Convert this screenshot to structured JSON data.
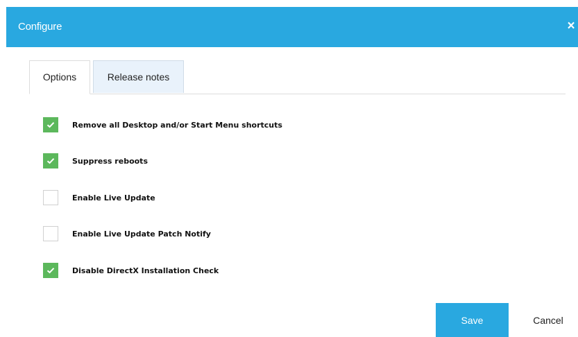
{
  "dialog": {
    "title": "Configure",
    "close_icon": "×",
    "accent_color": "#29a8e0",
    "check_color": "#5cb85c"
  },
  "tabs": [
    {
      "label": "Options",
      "active": true
    },
    {
      "label": "Release notes",
      "active": false
    }
  ],
  "options": [
    {
      "label": "Remove all Desktop and/or Start Menu shortcuts",
      "checked": true
    },
    {
      "label": "Suppress reboots",
      "checked": true
    },
    {
      "label": "Enable Live Update",
      "checked": false
    },
    {
      "label": "Enable Live Update Patch Notify",
      "checked": false
    },
    {
      "label": "Disable DirectX Installation Check",
      "checked": true
    }
  ],
  "buttons": {
    "save_label": "Save",
    "cancel_label": "Cancel"
  }
}
